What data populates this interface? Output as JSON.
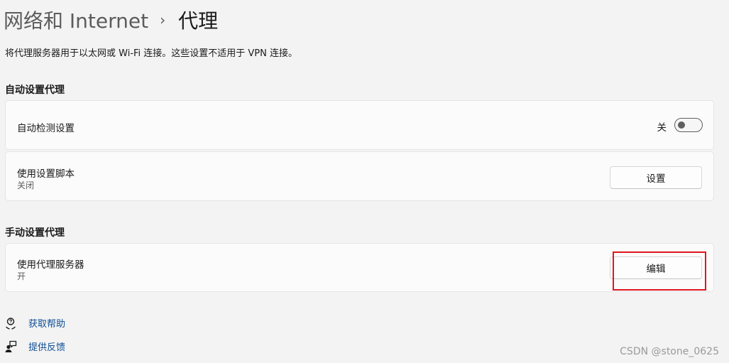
{
  "breadcrumb": {
    "parent": "网络和 Internet",
    "separator": "›",
    "current": "代理"
  },
  "description": "将代理服务器用于以太网或 Wi-Fi 连接。这些设置不适用于 VPN 连接。",
  "auto_section": {
    "title": "自动设置代理",
    "detect": {
      "label": "自动检测设置",
      "toggle_state": "关",
      "toggle_on": false
    },
    "script": {
      "label": "使用设置脚本",
      "sublabel": "关闭",
      "button_label": "设置"
    }
  },
  "manual_section": {
    "title": "手动设置代理",
    "proxy_server": {
      "label": "使用代理服务器",
      "sublabel": "开",
      "button_label": "编辑"
    }
  },
  "links": {
    "help": "获取帮助",
    "feedback": "提供反馈"
  },
  "watermark": "CSDN @stone_0625",
  "colors": {
    "background": "#f3f3f3",
    "card": "#fbfbfb",
    "link": "#0e4e97",
    "highlight": "#e0161e"
  },
  "icons": {
    "help": "help-icon",
    "feedback": "feedback-icon"
  }
}
